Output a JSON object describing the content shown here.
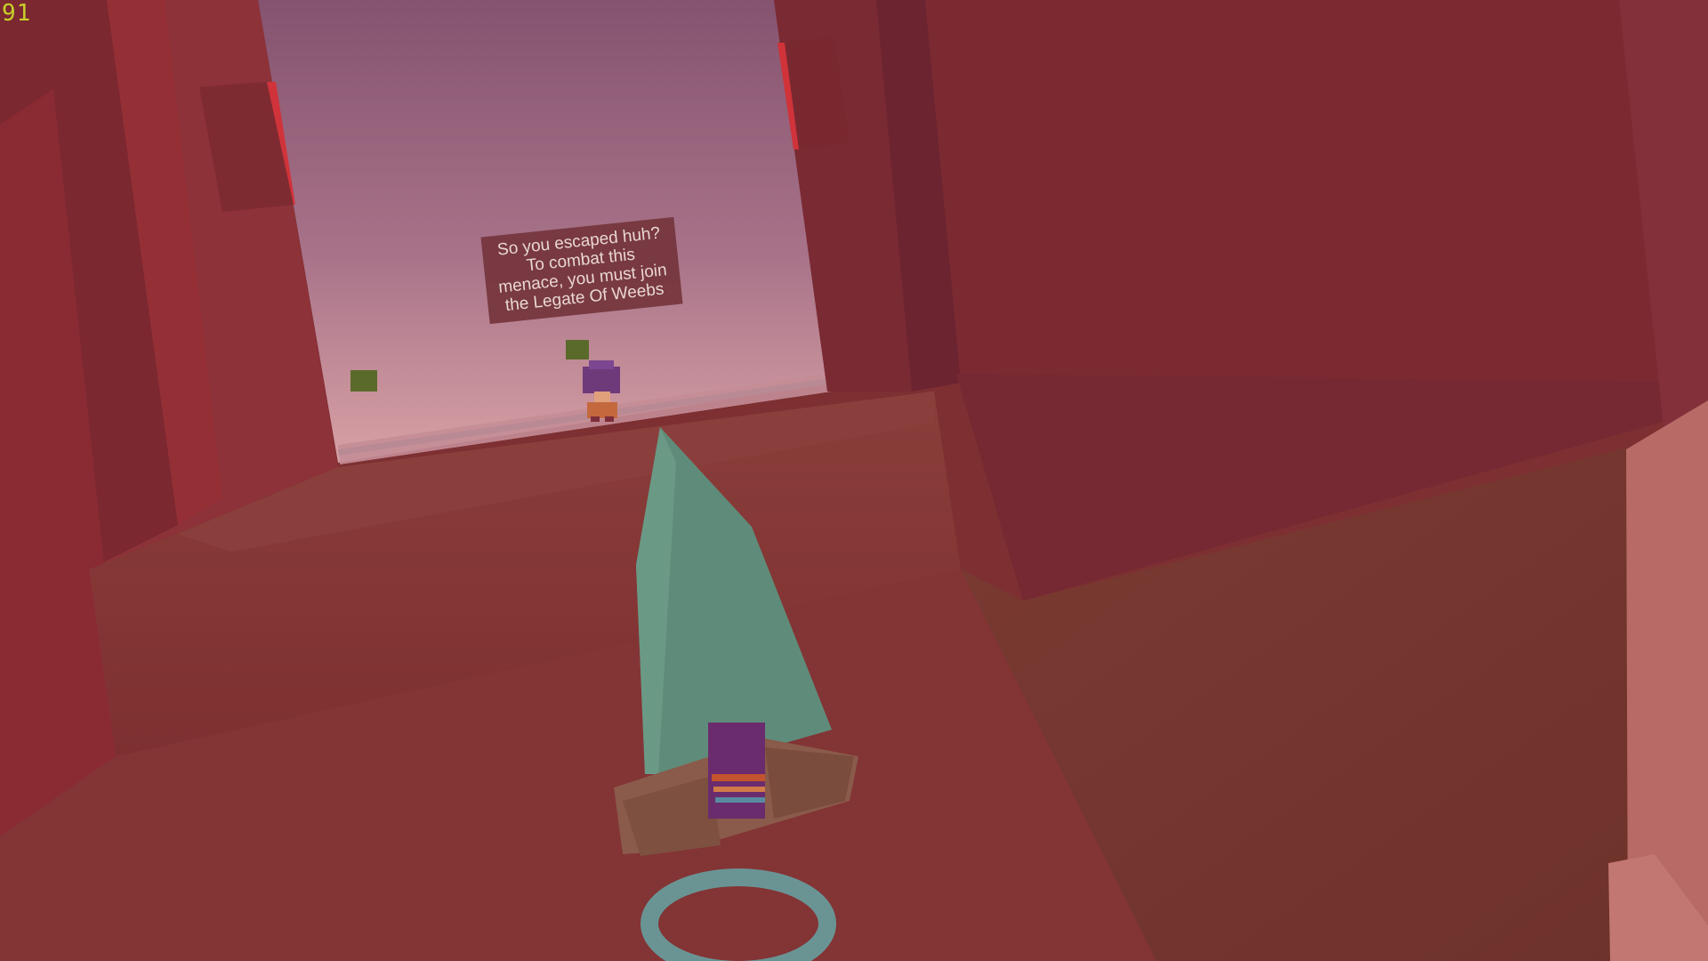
{
  "hud": {
    "fps": "91"
  },
  "npc_sign": {
    "lines": [
      "So you escaped huh?",
      "To combat this",
      "menace, you must join",
      "the Legate Of Weebs"
    ]
  },
  "colors": {
    "sky_top": "#8a5877",
    "sky_bottom": "#cf97a0",
    "wall": "#7c2a33",
    "floor": "#8a3a37",
    "blade": "#5f8c7a",
    "pickup_cube": "#5a6a2a",
    "ring": "#6a9494",
    "hud_text": "#c8cf2a"
  },
  "icons": {
    "weapon": "sword-icon",
    "pickup": "cube-icon",
    "npc": "character-icon",
    "target": "ring-icon"
  }
}
